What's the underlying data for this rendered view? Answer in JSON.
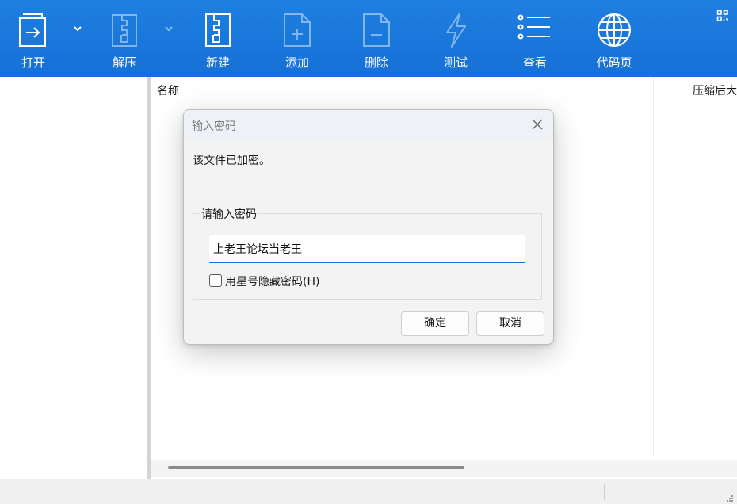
{
  "toolbar": {
    "background": "#1f7fe0",
    "buttons": [
      {
        "label": "打开",
        "icon": "open-file-icon",
        "enabled": true
      },
      {
        "label": "解压",
        "icon": "extract-zip-icon",
        "enabled": false
      },
      {
        "label": "新建",
        "icon": "new-archive-icon",
        "enabled": true
      },
      {
        "label": "添加",
        "icon": "add-file-icon",
        "enabled": false
      },
      {
        "label": "删除",
        "icon": "delete-file-icon",
        "enabled": false
      },
      {
        "label": "测试",
        "icon": "lightning-icon",
        "enabled": false
      },
      {
        "label": "查看",
        "icon": "list-view-icon",
        "enabled": true
      },
      {
        "label": "代码页",
        "icon": "globe-icon",
        "enabled": true
      }
    ]
  },
  "file_list": {
    "columns": [
      "名称",
      "压缩后大"
    ]
  },
  "dialog": {
    "title": "输入密码",
    "message": "该文件已加密。",
    "group_label": "请输入密码",
    "password_value": "上老王论坛当老王",
    "mask_checkbox_label": "用星号隐藏密码(H)",
    "mask_checked": false,
    "ok_label": "确定",
    "cancel_label": "取消",
    "accent": "#1a6fd0"
  }
}
